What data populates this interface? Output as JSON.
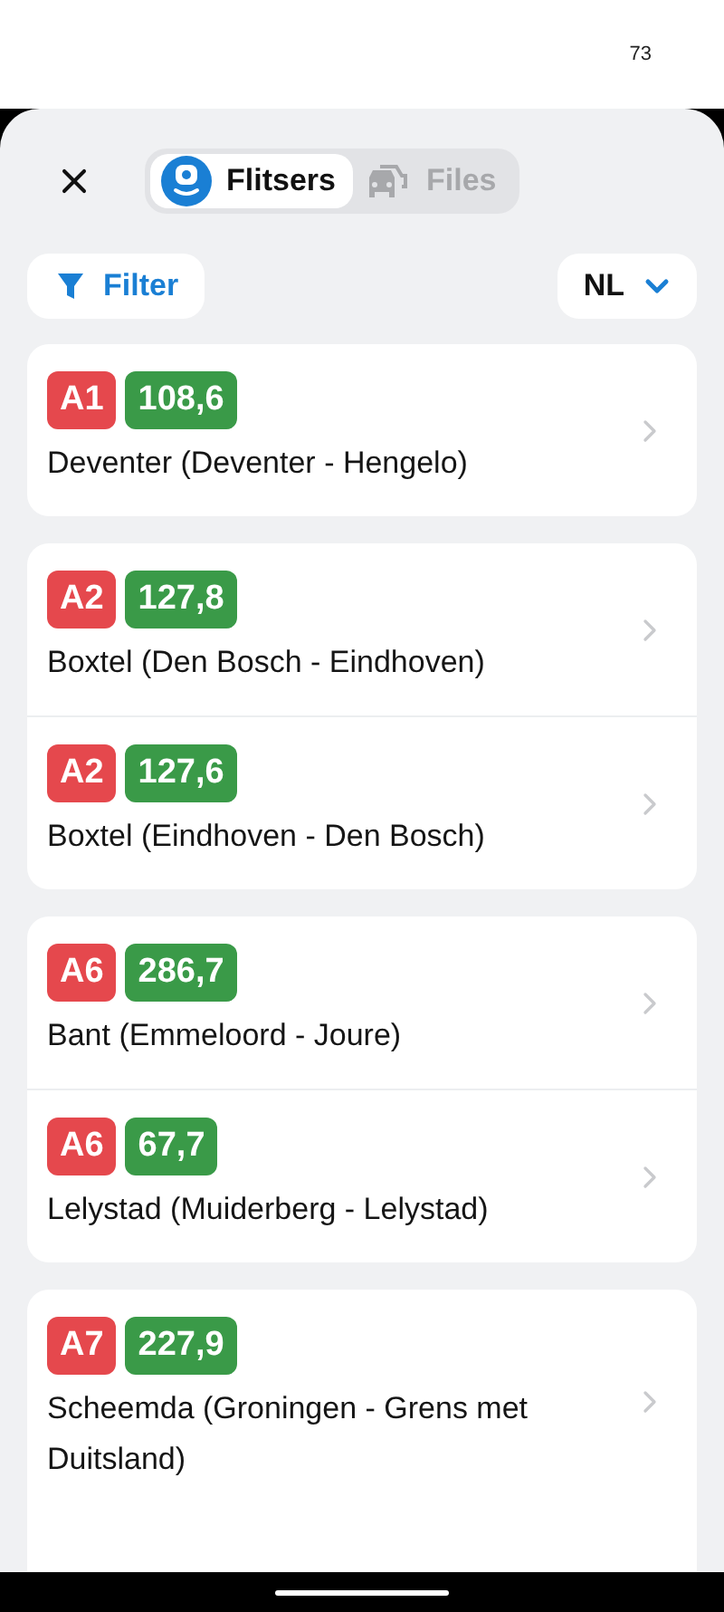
{
  "status_bar": {
    "battery": "73"
  },
  "tabs": [
    {
      "label": "Flitsers",
      "selected": true
    },
    {
      "label": "Files",
      "selected": false
    }
  ],
  "filter_button": {
    "label": "Filter"
  },
  "country_select": {
    "value": "NL"
  },
  "groups": [
    {
      "rows": [
        {
          "road": "A1",
          "km": "108,6",
          "location": "Deventer (Deventer - Hengelo)"
        }
      ]
    },
    {
      "rows": [
        {
          "road": "A2",
          "km": "127,8",
          "location": "Boxtel (Den Bosch - Eindhoven)"
        },
        {
          "road": "A2",
          "km": "127,6",
          "location": "Boxtel (Eindhoven - Den Bosch)"
        }
      ]
    },
    {
      "rows": [
        {
          "road": "A6",
          "km": "286,7",
          "location": "Bant (Emmeloord - Joure)"
        },
        {
          "road": "A6",
          "km": "67,7",
          "location": "Lelystad (Muiderberg - Lelystad)"
        }
      ]
    },
    {
      "rows": [
        {
          "road": "A7",
          "km": "227,9",
          "location": "Scheemda (Groningen - Grens met Duitsland)"
        }
      ]
    }
  ]
}
